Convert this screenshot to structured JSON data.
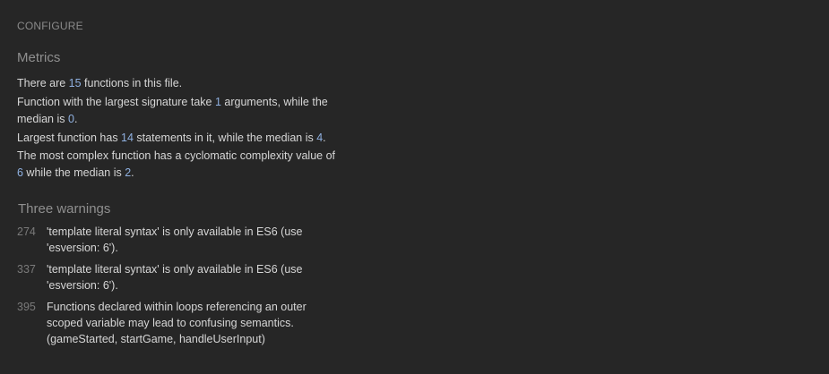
{
  "configure_label": "CONFIGURE",
  "metrics": {
    "title": "Metrics",
    "functions_count": {
      "prefix": "There are ",
      "value": "15",
      "suffix": " functions in this file."
    },
    "largest_signature": {
      "prefix": "Function with the largest signature take ",
      "value": "1",
      "middle": " arguments, while the median is ",
      "median": "0",
      "suffix": "."
    },
    "largest_function": {
      "prefix": "Largest function has ",
      "value": "14",
      "middle": " statements in it, while the median is ",
      "median": "4",
      "suffix": "."
    },
    "complexity": {
      "prefix": "The most complex function has a cyclomatic complexity value of ",
      "value": "6",
      "middle": " while the median is ",
      "median": "2",
      "suffix": "."
    }
  },
  "warnings": {
    "title": "Three warnings",
    "items": [
      {
        "line": "274",
        "message": "'template literal syntax' is only available in ES6 (use 'esversion: 6')."
      },
      {
        "line": "337",
        "message": "'template literal syntax' is only available in ES6 (use 'esversion: 6')."
      },
      {
        "line": "395",
        "message": "Functions declared within loops referencing an outer scoped variable may lead to confusing semantics. (gameStarted, startGame, handleUserInput)"
      }
    ]
  },
  "colors": {
    "background": "#262626",
    "number_accent": "#8fb0e0",
    "muted_heading": "#8f8f8f"
  }
}
